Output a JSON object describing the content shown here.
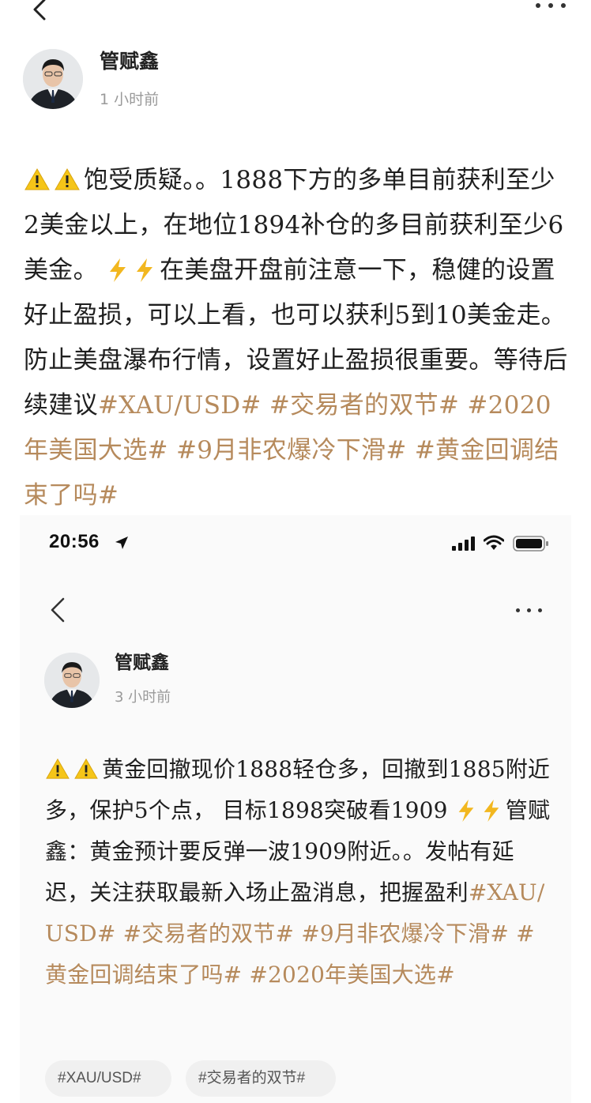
{
  "author": {
    "name": "管赋鑫",
    "time": "1 小时前"
  },
  "post": {
    "text1": "饱受质疑。。1888下方的多单目前获利至少2美金以上，在地位1894补仓的多目前获利至少6美金。",
    "text2": "在美盘开盘前注意一下，稳健的设置好止盈损，可以上看，也可以获利5到10美金走。防止美盘瀑布行情，设置好止盈损很重要。等待后续建议",
    "tags": [
      "#XAU/USD#",
      "#交易者的双节#",
      "#2020年美国大选#",
      "#9月非农爆冷下滑#",
      "#黄金回调结束了吗#"
    ]
  },
  "embedded": {
    "status_time": "20:56",
    "author": {
      "name": "管赋鑫",
      "time": "3 小时前"
    },
    "post": {
      "text1": "黄金回撤现价1888轻仓多，回撤到1885附近多，保护5个点， 目标1898突破看1909",
      "text2": "管赋鑫：黄金预计要反弹一波1909附近。。发帖有延迟，关注获取最新入场止盈消息，把握盈利",
      "tags": [
        "#XAU/USD#",
        "#交易者的双节#",
        "#9月非农爆冷下滑#",
        "#黄金回调结束了吗#",
        "#2020年美国大选#"
      ]
    },
    "chips": [
      "#XAU/USD#",
      "#交易者的双节#"
    ]
  },
  "icons": {
    "warning": "warning-icon",
    "lightning": "lightning-icon",
    "back": "back-chevron-icon",
    "more": "more-dots-icon"
  },
  "colors": {
    "tag": "#b68a5c",
    "warning": "#f5c518",
    "lightning": "#f2b71f",
    "secondary_text": "#9a9a9a"
  }
}
